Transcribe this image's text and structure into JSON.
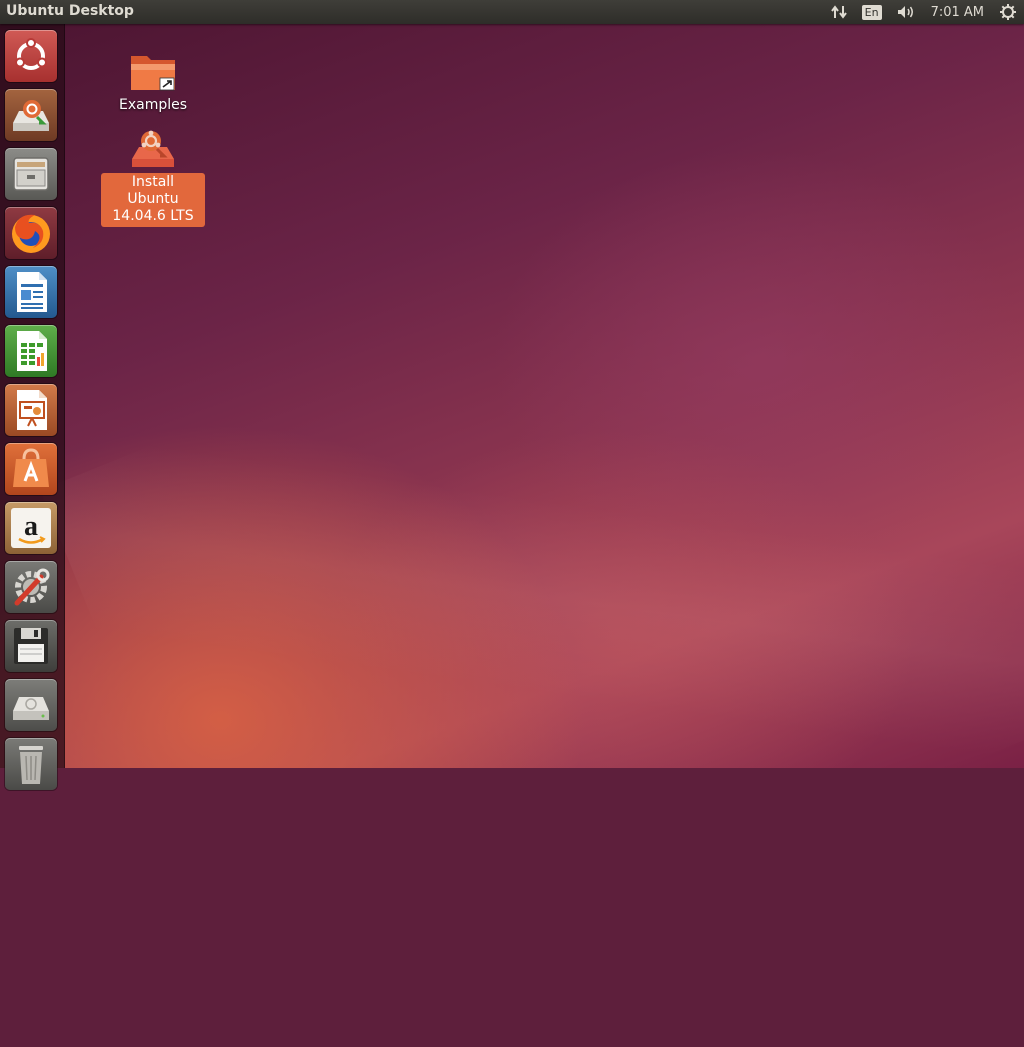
{
  "panel": {
    "title": "Ubuntu Desktop",
    "keyboard_layout": "En",
    "clock": "7:01 AM",
    "indicators": [
      "network-icon",
      "keyboard-layout",
      "volume-icon",
      "clock",
      "gear-icon"
    ]
  },
  "launcher": {
    "items": [
      {
        "name": "dash-home",
        "icon": "ubuntu-logo-icon"
      },
      {
        "name": "install-ubuntu",
        "icon": "installer-icon"
      },
      {
        "name": "files",
        "icon": "file-cabinet-icon"
      },
      {
        "name": "firefox",
        "icon": "firefox-icon"
      },
      {
        "name": "libreoffice-writer",
        "icon": "writer-icon"
      },
      {
        "name": "libreoffice-calc",
        "icon": "calc-icon"
      },
      {
        "name": "libreoffice-impress",
        "icon": "impress-icon"
      },
      {
        "name": "ubuntu-software-center",
        "icon": "software-center-icon"
      },
      {
        "name": "amazon",
        "icon": "amazon-icon"
      },
      {
        "name": "system-settings",
        "icon": "settings-icon"
      },
      {
        "name": "floppy",
        "icon": "floppy-icon"
      },
      {
        "name": "drive",
        "icon": "drive-icon"
      },
      {
        "name": "trash",
        "icon": "trash-icon"
      }
    ]
  },
  "desktop": {
    "icons": [
      {
        "label": "Examples",
        "icon": "folder-link-icon",
        "selected": false
      },
      {
        "label_line1": "Install Ubuntu",
        "label_line2": "14.04.6 LTS",
        "icon": "installer-icon",
        "selected": true
      }
    ]
  },
  "colors": {
    "panel": "#33322e",
    "panel_text": "#dfdbd2",
    "selection": "#e2683c",
    "wallpaper_dark": "#4a1430",
    "wallpaper_light": "#d66044"
  }
}
